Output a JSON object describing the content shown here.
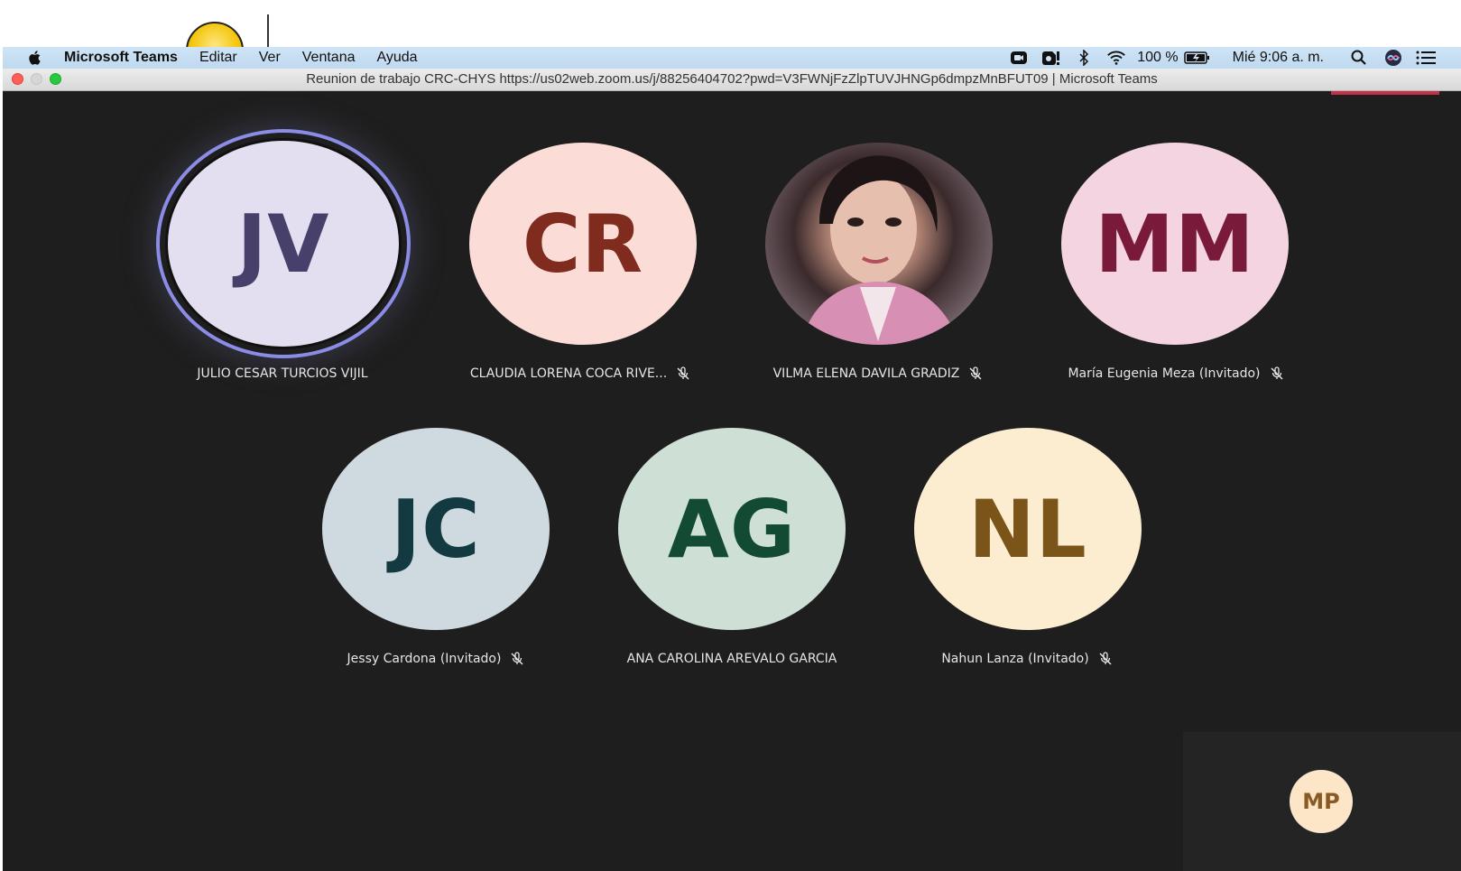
{
  "menubar": {
    "app_name": "Microsoft Teams",
    "menus": [
      "Editar",
      "Ver",
      "Ventana",
      "Ayuda"
    ],
    "battery": "100 %",
    "clock": "Mié 9:06 a. m."
  },
  "window": {
    "title": "Reunion de trabajo CRC-CHYS https://us02web.zoom.us/j/88256404702?pwd=V3FWNjFzZlpTUVJHNGp6dmpzMnBFUT09 | Microsoft Teams"
  },
  "participants": [
    {
      "initials": "JV",
      "name": "JULIO CESAR TURCIOS VIJIL",
      "bg": "#e3dff0",
      "fg": "#47406a",
      "muted": false,
      "speaking": true
    },
    {
      "initials": "CR",
      "name": "CLAUDIA LORENA COCA RIVE...",
      "bg": "#fbdcd7",
      "fg": "#7f2b1e",
      "muted": true,
      "speaking": false
    },
    {
      "initials": "",
      "name": "VILMA ELENA DAVILA GRADIZ",
      "bg": "#9a7f86",
      "fg": "#ffffff",
      "muted": true,
      "speaking": false,
      "photo": true
    },
    {
      "initials": "MM",
      "name": "María Eugenia Meza (Invitado)",
      "bg": "#f4d4e0",
      "fg": "#7a1a3b",
      "muted": true,
      "speaking": false
    },
    {
      "initials": "JC",
      "name": "Jessy Cardona (Invitado)",
      "bg": "#cfd9e0",
      "fg": "#123a40",
      "muted": true,
      "speaking": false
    },
    {
      "initials": "AG",
      "name": "ANA CAROLINA AREVALO GARCIA",
      "bg": "#cee0d6",
      "fg": "#124a34",
      "muted": false,
      "speaking": false
    },
    {
      "initials": "NL",
      "name": "Nahun Lanza (Invitado)",
      "bg": "#fcecd0",
      "fg": "#7a5418",
      "muted": true,
      "speaking": false
    }
  ],
  "self_view": {
    "initials": "MP"
  }
}
